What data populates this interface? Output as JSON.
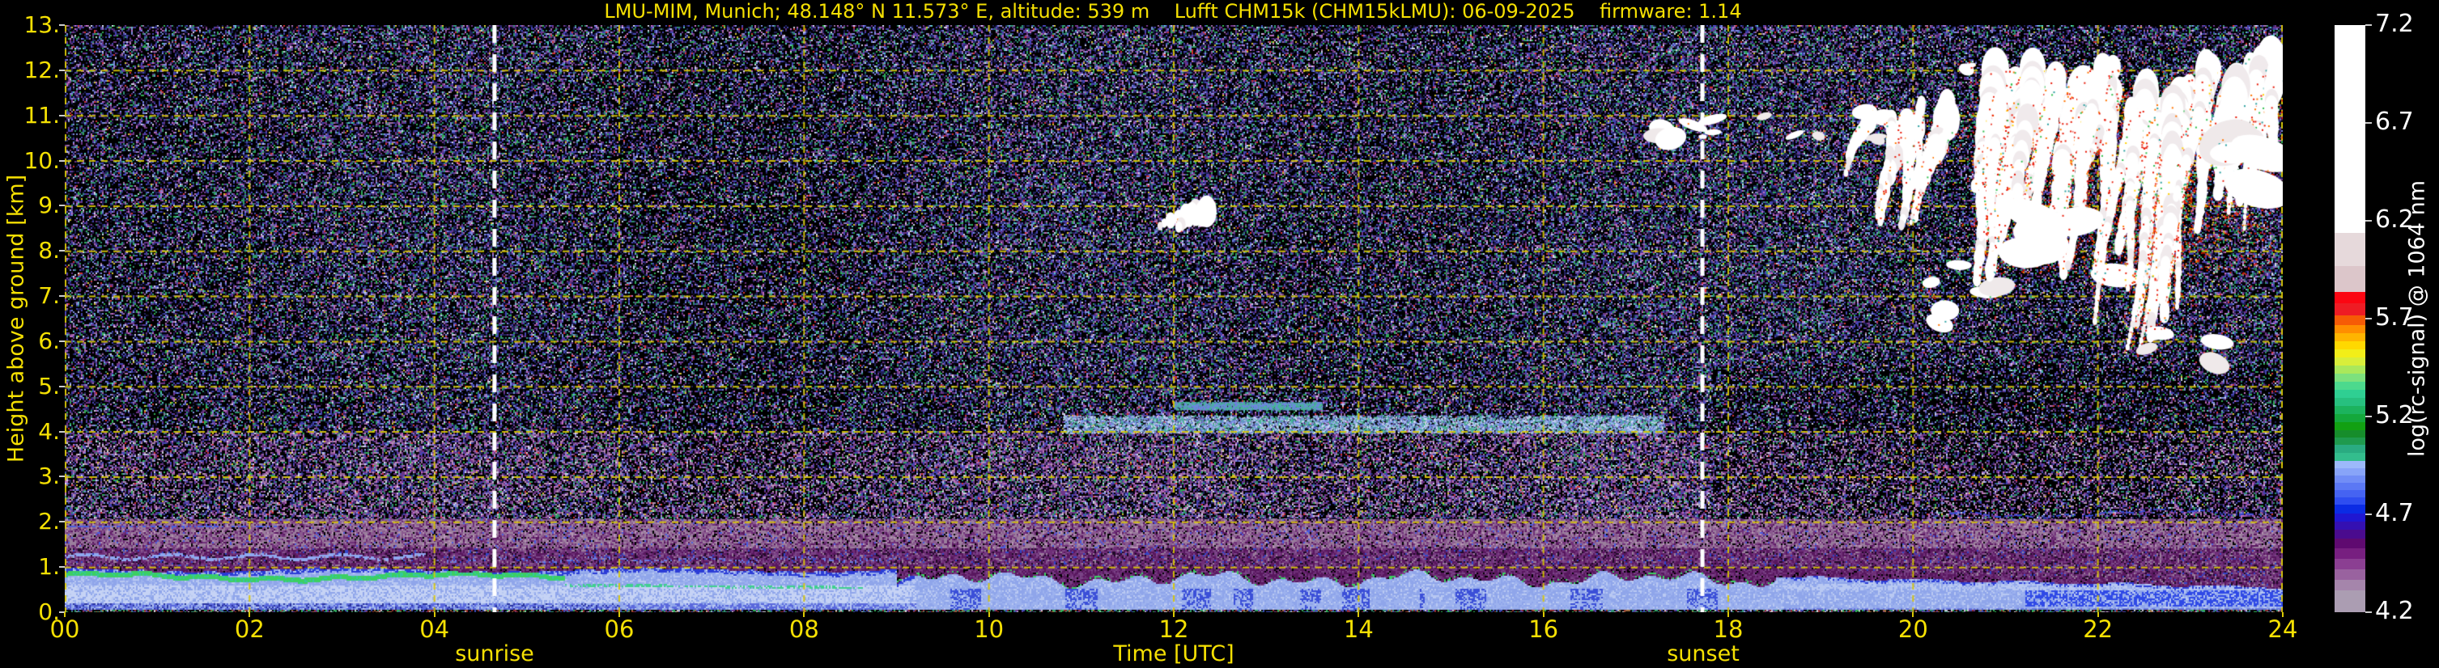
{
  "title": "LMU-MIM, Munich; 48.148° N 11.573° E, altitude: 539 m    Lufft CHM15k (CHM15kLMU): 06-09-2025    firmware: 1.14",
  "colors": {
    "label_yellow": "#f5e003",
    "grid_yellow": "#d9c804",
    "tick_white": "#cccccc",
    "background": "#000000",
    "sun_line": "#ffffff"
  },
  "plot": {
    "x_axis": {
      "label": "Time [UTC]",
      "ticks": [
        "00",
        "02",
        "04",
        "06",
        "08",
        "10",
        "12",
        "14",
        "16",
        "18",
        "20",
        "22",
        "24"
      ]
    },
    "y_axis": {
      "label": "Height above ground [km]",
      "ticks": [
        "0.",
        "1.",
        "2.",
        "3.",
        "4.",
        "5.",
        "6.",
        "7.",
        "8.",
        "9.",
        "10.",
        "11.",
        "12.",
        "13."
      ]
    },
    "annotations": {
      "sunrise": "sunrise",
      "sunset": "sunset"
    }
  },
  "colorbar": {
    "label": "log(rc-signal) @ 1064 nm",
    "ticks": [
      "4.2",
      "4.7",
      "5.2",
      "5.7",
      "6.2",
      "6.7",
      "7.2"
    ],
    "tick_values": [
      4.2,
      4.7,
      5.2,
      5.7,
      6.2,
      6.7,
      7.2
    ],
    "range": [
      4.2,
      7.2
    ],
    "segments": [
      {
        "c": "#ab9db2",
        "h": 0.111
      },
      {
        "c": "#a585ab",
        "h": 0.054
      },
      {
        "c": "#99629f",
        "h": 0.054
      },
      {
        "c": "#8b3f92",
        "h": 0.054
      },
      {
        "c": "#771f80",
        "h": 0.054
      },
      {
        "c": "#5f0a70",
        "h": 0.05
      },
      {
        "c": "#4a0b8e",
        "h": 0.045
      },
      {
        "c": "#3410b2",
        "h": 0.041
      },
      {
        "c": "#1f17d2",
        "h": 0.041
      },
      {
        "c": "#0b2be4",
        "h": 0.046
      },
      {
        "c": "#2e4df0",
        "h": 0.037
      },
      {
        "c": "#4563f2",
        "h": 0.037
      },
      {
        "c": "#5b78f4",
        "h": 0.037
      },
      {
        "c": "#718df6",
        "h": 0.037
      },
      {
        "c": "#88a4f8",
        "h": 0.037
      },
      {
        "c": "#9cb9fa",
        "h": 0.037
      },
      {
        "c": "#33bd8d",
        "h": 0.041
      },
      {
        "c": "#2aab81",
        "h": 0.041
      },
      {
        "c": "#1f9a4e",
        "h": 0.039
      },
      {
        "c": "#168d2b",
        "h": 0.039
      },
      {
        "c": "#12a012",
        "h": 0.041
      },
      {
        "c": "#14a83c",
        "h": 0.041
      },
      {
        "c": "#1cb35e",
        "h": 0.041
      },
      {
        "c": "#27c07f",
        "h": 0.041
      },
      {
        "c": "#2fcf92",
        "h": 0.041
      },
      {
        "c": "#4cd98d",
        "h": 0.041
      },
      {
        "c": "#7de17d",
        "h": 0.041
      },
      {
        "c": "#aae85b",
        "h": 0.041
      },
      {
        "c": "#d8ee3a",
        "h": 0.041
      },
      {
        "c": "#f2ee18",
        "h": 0.041
      },
      {
        "c": "#ffd800",
        "h": 0.041
      },
      {
        "c": "#ffb400",
        "h": 0.041
      },
      {
        "c": "#ff8e00",
        "h": 0.043
      },
      {
        "c": "#f65b06",
        "h": 0.05
      },
      {
        "c": "#ee1c24",
        "h": 0.06
      },
      {
        "c": "#fb0612",
        "h": 0.06
      },
      {
        "c": "#dcc6ca",
        "h": 0.13
      },
      {
        "c": "#e6d9db",
        "h": 0.17
      },
      {
        "c": "#ffffff",
        "h": 1.063
      }
    ]
  },
  "chart_data": {
    "type": "heatmap",
    "title": "LMU-MIM, Munich; 48.148° N 11.573° E, altitude: 539 m    Lufft CHM15k (CHM15kLMU): 06-09-2025    firmware: 1.14",
    "xlabel": "Time [UTC]",
    "ylabel": "Height above ground [km]",
    "x_range_hours": [
      0,
      24
    ],
    "x_tick_step_hours": 2,
    "y_range_km": [
      0,
      13
    ],
    "y_tick_step_km": 1,
    "colorbar_label": "log(rc-signal) @ 1064 nm",
    "colorbar_range": [
      4.2,
      7.2
    ],
    "colorbar_ticks": [
      4.2,
      4.7,
      5.2,
      5.7,
      6.2,
      6.7,
      7.2
    ],
    "sunrise_utc": 4.65,
    "sunset_utc": 17.72,
    "grid": "yellow dashed, every 1 km and every 2 h",
    "features": [
      "speckled instrument-noise background above ~2 km",
      "purple-grey residual aerosol band 1.0-2.0 km persisting all 24 h",
      "nocturnal boundary layer 0-0.95 km with bright green gradient line near 0.8 km from 00:00 to ~05:30, descending teal line until ~08:40",
      "convective boundary-layer plumes (light blue) 09:00-18:30 reaching ~1 km with green tips",
      "evening stratified layer after 18:30; purple wedge descending from 1.0 to ~0.55 km by 24:00, bright blue band 0.15-0.5 km after 21:00",
      "faint elevated aerosol layer ~4.0-4.35 km between 11:00 and 17:20",
      "small cirrus patch 8.3-9.0 km near 12:15",
      "row of small cloud blobs 10.45-11.1 km between 17:10 and 19:50",
      "extensive cirrus fall-streaks 5-12.3 km from 19:20 to 24:00 with white cores and red/orange fringes plus green specks",
      "dark multicoloured overlap-noise strip below ~0.08 km"
    ],
    "render": {
      "seed": 42,
      "noise_hi": [
        [
          0.4,
          "#000000"
        ],
        [
          0.53,
          "#20205a"
        ],
        [
          0.63,
          "#4444b2"
        ],
        [
          0.72,
          "#6d3588"
        ],
        [
          0.78,
          "#2f8f70"
        ],
        [
          0.83,
          "#7d8ce0"
        ],
        [
          0.87,
          "#9a6ba2"
        ],
        [
          0.9,
          "#2fae52"
        ],
        [
          0.925,
          "#c06ec0"
        ],
        [
          0.945,
          "#cfd3e8"
        ],
        [
          0.955,
          "#d03030"
        ],
        [
          0.965,
          "#d0c030"
        ],
        [
          0.975,
          "#55c8c0"
        ],
        [
          1.0,
          "#101028"
        ]
      ],
      "noise_mid": [
        [
          0.3,
          "#000000"
        ],
        [
          0.47,
          "#6d3588"
        ],
        [
          0.58,
          "#9a6ba2"
        ],
        [
          0.67,
          "#4444b2"
        ],
        [
          0.74,
          "#20205a"
        ],
        [
          0.8,
          "#b795b5"
        ],
        [
          0.85,
          "#2f8f70"
        ],
        [
          0.89,
          "#c06ec0"
        ],
        [
          0.925,
          "#7d8ce0"
        ],
        [
          0.95,
          "#2fae52"
        ],
        [
          0.96,
          "#d03030"
        ],
        [
          0.97,
          "#d0c030"
        ],
        [
          1.0,
          "#cfd3e8"
        ]
      ],
      "band_hi": [
        [
          0.3,
          "#9b7f9d"
        ],
        [
          0.55,
          "#8a5a8f"
        ],
        [
          0.72,
          "#6f2f78"
        ],
        [
          0.82,
          "#58175e"
        ],
        [
          0.9,
          "#000000"
        ],
        [
          0.96,
          "#b795b5"
        ],
        [
          1.0,
          "#4a5ce0"
        ]
      ],
      "band_lo": [
        [
          0.3,
          "#58175e"
        ],
        [
          0.55,
          "#6f2f78"
        ],
        [
          0.7,
          "#7a4587"
        ],
        [
          0.83,
          "#200a28"
        ],
        [
          0.91,
          "#9b7f9d"
        ],
        [
          0.96,
          "#3346c8"
        ],
        [
          1.0,
          "#8a5a8f"
        ]
      ],
      "surface": [
        [
          0.42,
          "#000000"
        ],
        [
          0.52,
          "#902828"
        ],
        [
          0.62,
          "#2f8f70"
        ],
        [
          0.74,
          "#3a48b0"
        ],
        [
          0.8,
          "#c8c8d0"
        ],
        [
          0.86,
          "#a06838"
        ],
        [
          0.93,
          "#6d3588"
        ],
        [
          1.0,
          "#2fae52"
        ]
      ],
      "bl": {
        "base1": "#8fa5ea",
        "base2": "#9db2ee",
        "base3": "#b9c9f2",
        "core": "#c6d3f5",
        "deep": "#3b4fd8",
        "mid": "#5a68dc",
        "dark": "#2a34a0",
        "bright": "#2f49e6",
        "green": "#3ccf63",
        "teal": "#35c79d",
        "teal2": "#3fcf8f",
        "ptop1": "#58175e",
        "ptop2": "#6f2f78",
        "edge": "#2b3cd6"
      },
      "clouds": [
        {
          "kind": "blobs",
          "t0": 17.15,
          "t1": 19.85,
          "k0": 10.45,
          "k1": 11.1,
          "n": 15,
          "wMin": 5,
          "wMax": 20,
          "red": 0.25
        },
        {
          "kind": "blobs",
          "t0": 20.55,
          "t1": 21.2,
          "k0": 11.9,
          "k1": 12.25,
          "n": 4,
          "wMin": 4,
          "wMax": 12,
          "red": 0.2
        },
        {
          "kind": "streaks",
          "t0": 12.1,
          "t1": 12.45,
          "top": 8.95,
          "bot": 8.25,
          "n": 2,
          "w": 6,
          "red": 0.15,
          "green": 0.05
        },
        {
          "kind": "streaks",
          "t0": 19.35,
          "t1": 20.6,
          "top": 11.4,
          "bot": 8.5,
          "n": 9,
          "w": 10,
          "red": 0.45,
          "green": 0.2
        },
        {
          "kind": "blobs",
          "t0": 20.15,
          "t1": 20.95,
          "k0": 6.1,
          "k1": 7.7,
          "n": 6,
          "wMin": 10,
          "wMax": 26,
          "red": 0.5
        },
        {
          "kind": "haze",
          "t0": 20.9,
          "t1": 23.9,
          "k0": 7.5,
          "k1": 12.0,
          "n": 2600
        },
        {
          "kind": "streaks",
          "t0": 20.85,
          "t1": 22.3,
          "top": 12.2,
          "bot": 7.2,
          "n": 16,
          "w": 13,
          "red": 0.8,
          "green": 0.35
        },
        {
          "kind": "blobs",
          "t0": 21.0,
          "t1": 22.2,
          "k0": 7.4,
          "k1": 9.4,
          "n": 6,
          "wMin": 18,
          "wMax": 40,
          "red": 0.5
        },
        {
          "kind": "streaks",
          "t0": 22.25,
          "t1": 23.2,
          "top": 11.8,
          "bot": 5.6,
          "n": 12,
          "w": 11,
          "red": 0.85,
          "green": 0.3
        },
        {
          "kind": "blobs",
          "t0": 22.5,
          "t1": 23.45,
          "k0": 5.5,
          "k1": 6.35,
          "n": 5,
          "wMin": 9,
          "wMax": 22,
          "red": 0.5
        },
        {
          "kind": "streaks",
          "t0": 23.15,
          "t1": 23.98,
          "top": 12.3,
          "bot": 8.4,
          "n": 10,
          "w": 12,
          "red": 0.6,
          "green": 0.25
        },
        {
          "kind": "blobs",
          "t0": 23.3,
          "t1": 23.95,
          "k0": 8.6,
          "k1": 10.6,
          "n": 4,
          "wMin": 20,
          "wMax": 44,
          "red": 0.4
        }
      ]
    }
  }
}
